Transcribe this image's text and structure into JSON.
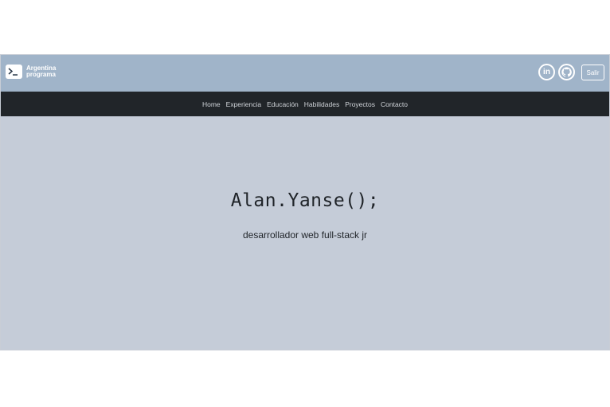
{
  "header": {
    "logo_line1": "Argentina",
    "logo_line2": "programa",
    "linkedin_label": "in",
    "logout_label": "Salir",
    "bg_color": "#a0b4c9"
  },
  "nav": {
    "items": [
      {
        "label": "Home"
      },
      {
        "label": "Experiencia"
      },
      {
        "label": "Educación"
      },
      {
        "label": "Habilidades"
      },
      {
        "label": "Proyectos"
      },
      {
        "label": "Contacto"
      }
    ],
    "bg_color": "#212529"
  },
  "hero": {
    "title": "Alan.Yanse();",
    "subtitle": "desarrollador web full-stack jr",
    "bg_color": "#c5ccd8"
  },
  "icons": {
    "logo": "terminal-icon",
    "linkedin": "linkedin-icon",
    "github": "github-icon"
  }
}
